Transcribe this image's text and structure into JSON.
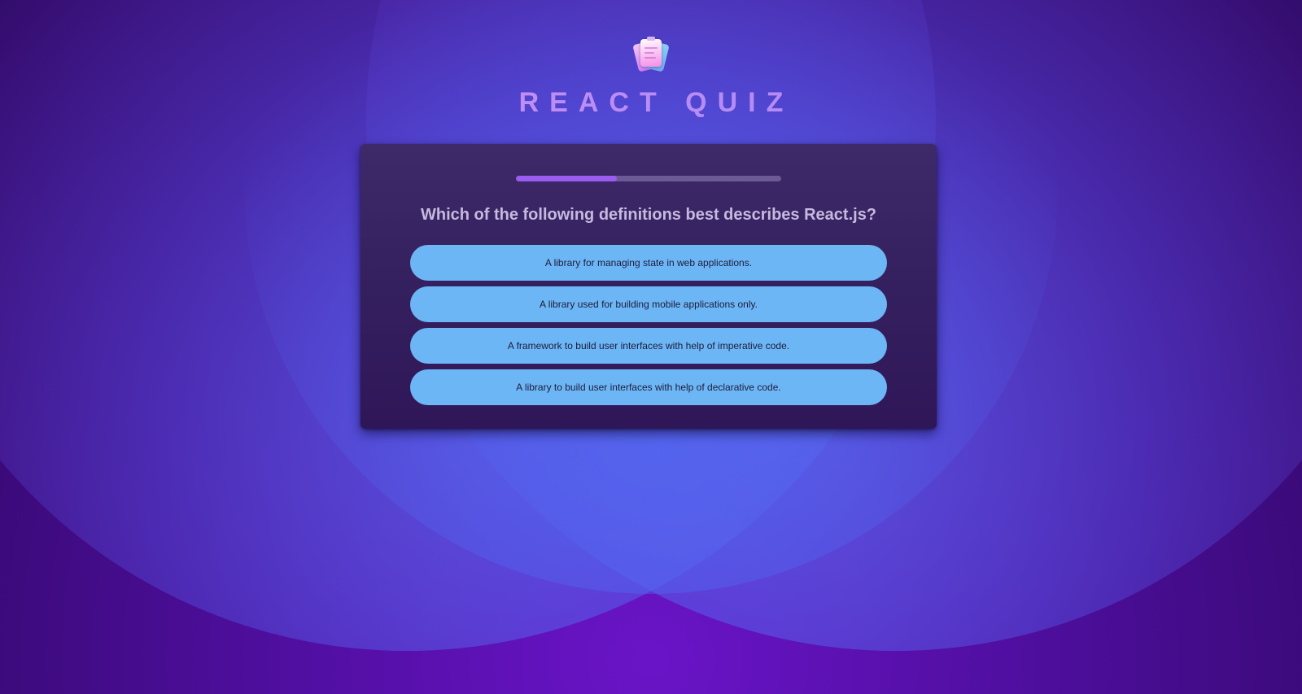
{
  "header": {
    "logo_icon": "quiz-cards-icon",
    "title": "REACT QUIZ"
  },
  "quiz": {
    "progress_fraction": 0.38,
    "question": "Which of the following definitions best describes React.js?",
    "answers": [
      "A library for managing state in web applications.",
      "A library used for building mobile applications only.",
      "A framework to build user interfaces with help of imperative code.",
      "A library to build user interfaces with help of declarative code."
    ]
  },
  "colors": {
    "background": "#4c0e9a",
    "card": "#35205f",
    "answer_button": "#6db6f5",
    "progress_fill": "#9b5cf2",
    "progress_track": "#6c5a96"
  }
}
